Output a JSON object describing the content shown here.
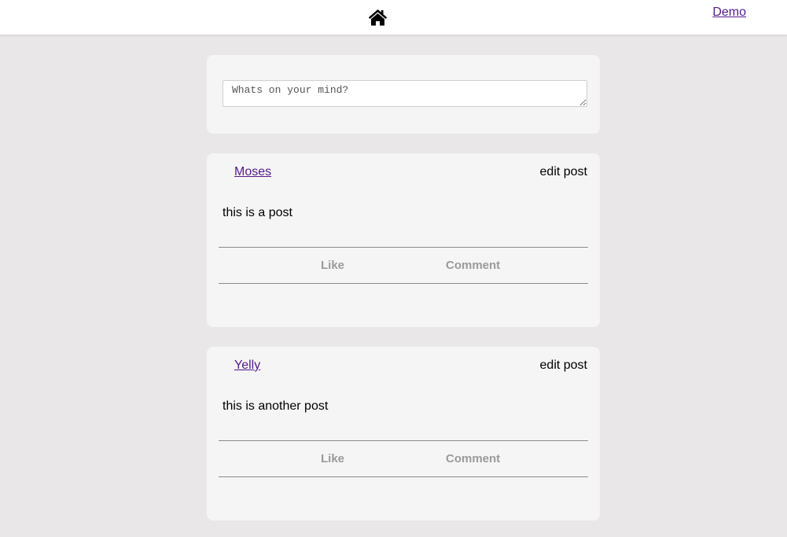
{
  "nav": {
    "home_icon": "home-icon",
    "user_link": "Demo"
  },
  "composer": {
    "placeholder": "Whats on your mind?"
  },
  "posts": [
    {
      "author": "Moses",
      "edit_label": "edit post",
      "text": "this is a post",
      "like_label": "Like",
      "comment_label": "Comment"
    },
    {
      "author": "Yelly",
      "edit_label": "edit post",
      "text": "this is another post",
      "like_label": "Like",
      "comment_label": "Comment"
    }
  ],
  "colors": {
    "background": "#e9e7e8",
    "card": "#f5f5f5",
    "link": "#551a8b",
    "action_text": "#9a9a9a"
  }
}
